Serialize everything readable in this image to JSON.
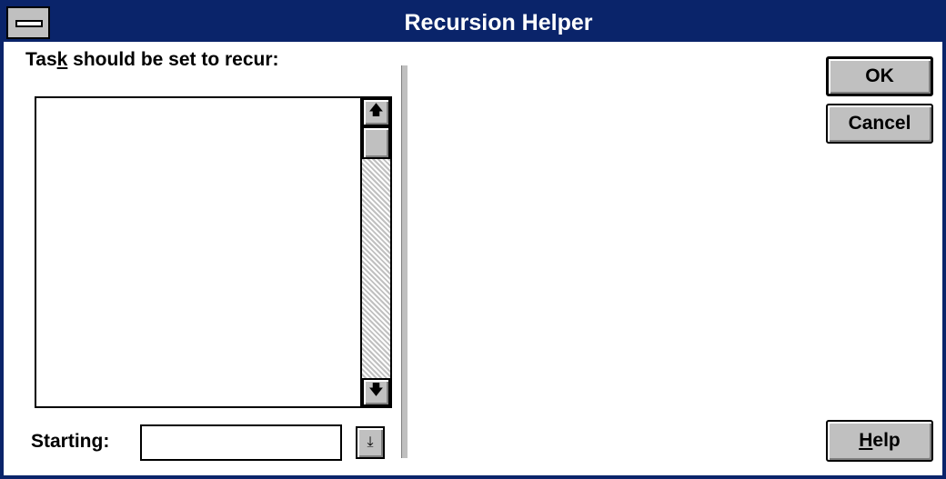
{
  "window": {
    "title": "Recursion Helper"
  },
  "task_label": {
    "pre": "Tas",
    "accel": "k",
    "post": " should be set to recur:"
  },
  "starting_label": {
    "pre": "Startin",
    "accel": "g",
    "post": ":"
  },
  "starting_value": "",
  "buttons": {
    "ok": "OK",
    "cancel": "Cancel",
    "help_accel": "H",
    "help_rest": "elp"
  },
  "glyphs": {
    "up_arrow": "🡅",
    "down_arrow": "🡇",
    "combo_arrow": "⤓"
  },
  "colors": {
    "titlebar": "#0a246a",
    "face": "#c0c0c0"
  }
}
